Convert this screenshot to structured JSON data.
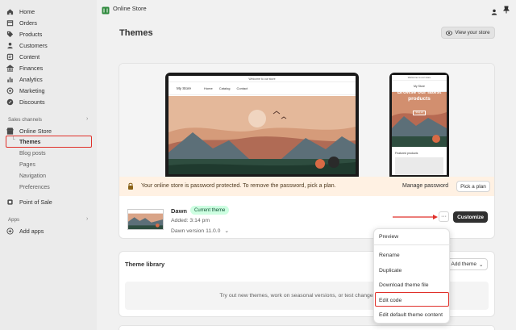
{
  "sidebar": {
    "items": [
      {
        "label": "Home",
        "icon": "home-icon"
      },
      {
        "label": "Orders",
        "icon": "orders-icon"
      },
      {
        "label": "Products",
        "icon": "tag-icon"
      },
      {
        "label": "Customers",
        "icon": "person-icon"
      },
      {
        "label": "Content",
        "icon": "content-icon"
      },
      {
        "label": "Finances",
        "icon": "bank-icon"
      },
      {
        "label": "Analytics",
        "icon": "chart-icon"
      },
      {
        "label": "Marketing",
        "icon": "target-icon"
      },
      {
        "label": "Discounts",
        "icon": "discount-icon"
      }
    ],
    "sales_channels_label": "Sales channels",
    "online_store_label": "Online Store",
    "sub_items": [
      "Themes",
      "Blog posts",
      "Pages",
      "Navigation",
      "Preferences"
    ],
    "point_of_sale_label": "Point of Sale",
    "apps_label": "Apps",
    "add_apps_label": "Add apps"
  },
  "topbar": {
    "title": "Online Store"
  },
  "page": {
    "title": "Themes",
    "view_store_label": "View your store"
  },
  "preview": {
    "announcement": "Welcome to our store",
    "store_name": "My Store",
    "nav_links": [
      "Home",
      "Catalog",
      "Contact"
    ],
    "phone_hero_text": "Browse our latest products",
    "phone_button": "Shop all",
    "featured_label": "Featured products"
  },
  "banner": {
    "message": "Your online store is password protected. To remove the password, pick a plan.",
    "manage_label": "Manage password",
    "pick_label": "Pick a plan"
  },
  "current_theme": {
    "name": "Dawn",
    "badge": "Current theme",
    "added": "Added: 3:14 pm",
    "version": "Dawn version 11.0.0",
    "more_label": "···",
    "customize_label": "Customize"
  },
  "library": {
    "title": "Theme library",
    "add_label": "Add theme",
    "empty_text": "Try out new themes, work on seasonal versions, or test changes to your"
  },
  "menu": {
    "items": [
      "Preview",
      "Rename",
      "Duplicate",
      "Download theme file",
      "Edit code",
      "Edit default theme content"
    ]
  },
  "colors": {
    "highlight": "#e0302a",
    "badge_bg": "#cdfee1",
    "banner_bg": "#fff1e3",
    "primary_button": "#303030"
  }
}
